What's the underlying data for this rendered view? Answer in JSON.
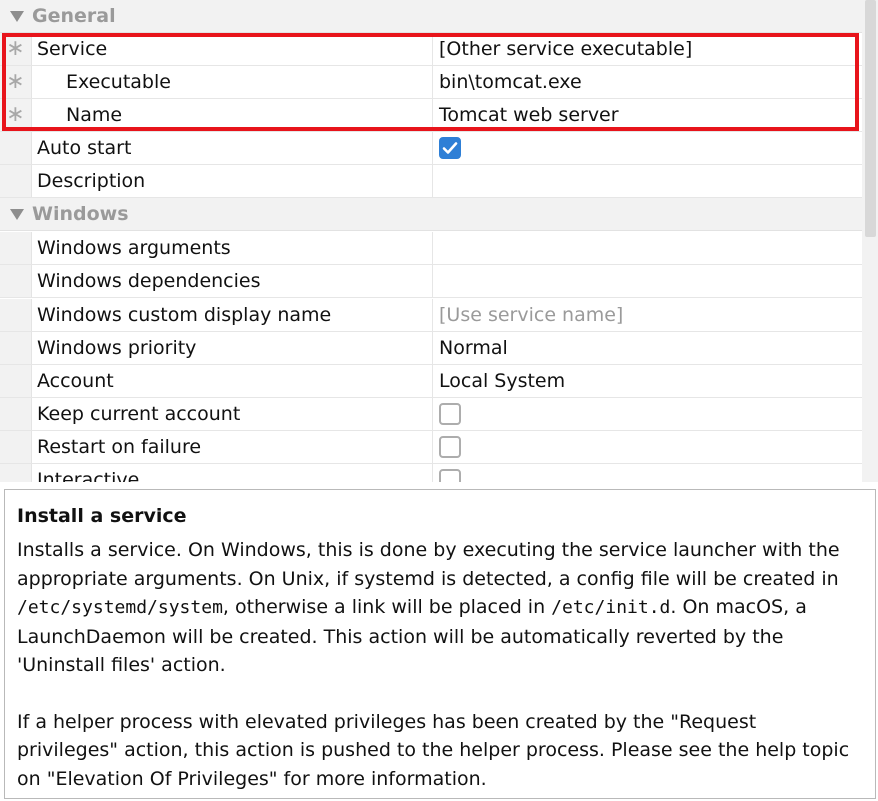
{
  "property_grid": {
    "categories": {
      "general": "General",
      "windows": "Windows"
    },
    "required_marker": "∗",
    "rows": {
      "service": {
        "name": "Service",
        "value": "[Other service executable]"
      },
      "executable": {
        "name": "Executable",
        "value": "bin\\tomcat.exe"
      },
      "service_name": {
        "name": "Name",
        "value": "Tomcat web server"
      },
      "auto_start": {
        "name": "Auto start",
        "checked": true
      },
      "description": {
        "name": "Description",
        "value": ""
      },
      "windows_arguments": {
        "name": "Windows arguments",
        "value": ""
      },
      "windows_dependencies": {
        "name": "Windows dependencies",
        "value": ""
      },
      "windows_custom_display_name": {
        "name": "Windows custom display name",
        "placeholder": "[Use service name]"
      },
      "windows_priority": {
        "name": "Windows priority",
        "value": "Normal"
      },
      "account": {
        "name": "Account",
        "value": "Local System"
      },
      "keep_current_account": {
        "name": "Keep current account",
        "checked": false
      },
      "restart_on_failure": {
        "name": "Restart on failure",
        "checked": false
      },
      "interactive": {
        "name": "Interactive",
        "checked": false
      }
    }
  },
  "help": {
    "title": "Install a service",
    "p1_a": "Installs a service. On Windows, this is done by executing the service launcher with the appropriate arguments. On Unix, if systemd is detected, a config file will be created in ",
    "p1_code1": "/etc/systemd/system",
    "p1_b": ", otherwise a link will be placed in ",
    "p1_code2": "/etc/init.d",
    "p1_c": ". On macOS, a LaunchDaemon will be created. This action will be automatically reverted by the 'Uninstall files' action.",
    "p2": "If a helper process with elevated privileges has been created by the \"Request privileges\" action, this action is pushed to the helper process. Please see the help topic on \"Elevation Of Privileges\" for more information."
  },
  "colors": {
    "highlight": "#e8141b",
    "checkbox_checked": "#2e7fd6"
  }
}
